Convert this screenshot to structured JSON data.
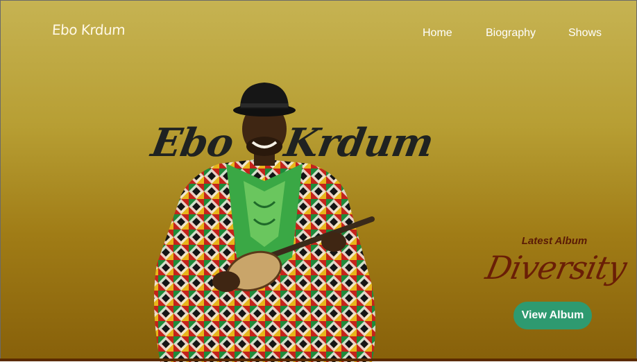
{
  "brand": {
    "logo": "Ebo Krdum"
  },
  "nav": {
    "items": [
      "Home",
      "Biography",
      "Shows"
    ]
  },
  "hero": {
    "artist_first": "Ebo",
    "artist_last": "Krdum"
  },
  "album": {
    "label": "Latest Album",
    "title": "Diversity",
    "button": "View Album"
  },
  "colors": {
    "accent_button": "#2e9a70",
    "album_text": "#6a1e06",
    "background_top": "#c6b352",
    "background_bottom": "#87600a"
  }
}
